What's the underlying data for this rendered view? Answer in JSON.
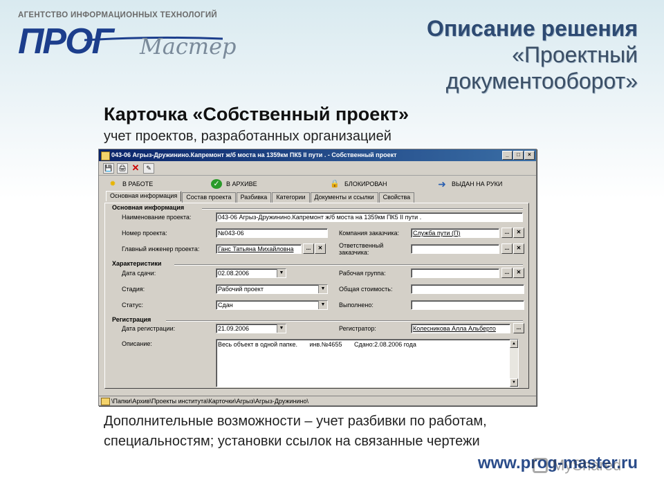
{
  "logo": {
    "top_line": "АГЕНТСТВО ИНФОРМАЦИОННЫХ ТЕХНОЛОГИЙ",
    "word": "ПРОГ",
    "script": "Мастер"
  },
  "heading": {
    "line1": "Описание решения",
    "line2": "«Проектный",
    "line3": "документооборот»"
  },
  "card": {
    "title": "Карточка «Собственный проект»",
    "subtitle": "учет проектов, разработанных организацией"
  },
  "window": {
    "title": "043-06 Агрыз-Дружинино.Капремонт ж/б моста на 1359км ПК5 II пути . - Собственный проект",
    "controls": {
      "minimize": "_",
      "maximize": "□",
      "close": "×"
    },
    "toolbar": {
      "save": "💾",
      "print": "🖨",
      "delete": "✕",
      "edit": "✎"
    },
    "status_buttons": [
      {
        "label": "В РАБОТЕ",
        "icon": "gear-icon",
        "color": "#e8b400"
      },
      {
        "label": "В АРХИВЕ",
        "icon": "check-icon",
        "color": "#2a9a2a"
      },
      {
        "label": "БЛОКИРОВАН",
        "icon": "lock-icon",
        "color": "#d4a800"
      },
      {
        "label": "ВЫДАН НА РУКИ",
        "icon": "arrow-right-icon",
        "color": "#2a5fb0"
      }
    ],
    "tabs": [
      "Основная информация",
      "Состав проекта",
      "Разбивка",
      "Категории",
      "Документы и ссылки",
      "Свойства"
    ],
    "sections": {
      "main": "Основная информация",
      "chars": "Характеристики",
      "reg": "Регистрация"
    },
    "labels": {
      "name": "Наименование проекта:",
      "number": "Номер проекта:",
      "customer": "Компания заказчика:",
      "chief": "Главный инженер проекта:",
      "responsible": "Ответственный заказчика:",
      "due": "Дата сдачи:",
      "workgroup": "Рабочая группа:",
      "stage": "Стадия:",
      "total_cost": "Общая стоимость:",
      "status": "Статус:",
      "done": "Выполнено:",
      "reg_date": "Дата регистрации:",
      "registrar": "Регистратор:",
      "description": "Описание:"
    },
    "values": {
      "name": "043-06 Агрыз-Дружинино.Капремонт ж/б моста на 1359км ПК5 II пути .",
      "number": "№043-06",
      "customer": "Служба пути (П)",
      "chief": "Ганс Татьяна Михайловна",
      "responsible": "",
      "due": "02.08.2006",
      "workgroup": "",
      "stage": "Рабочий проект",
      "total_cost": "",
      "status": "Сдан",
      "done": "",
      "reg_date": "21.09.2006",
      "registrar": "Колесникова Алла Альберто",
      "description": "Весь объект в одной папке.       инв.№4655       Сдано:2.08.2006 года"
    },
    "path": "\\Папки\\Архив\\Проекты института\\Карточки\\Агрыз\\Агрыз-Дружинино\\"
  },
  "extra_text": "Дополнительные возможности – учет разбивки по работам, специальностям; установки ссылок на связанные чертежи",
  "site": "www.prog-master.ru",
  "watermark": "MyShared"
}
